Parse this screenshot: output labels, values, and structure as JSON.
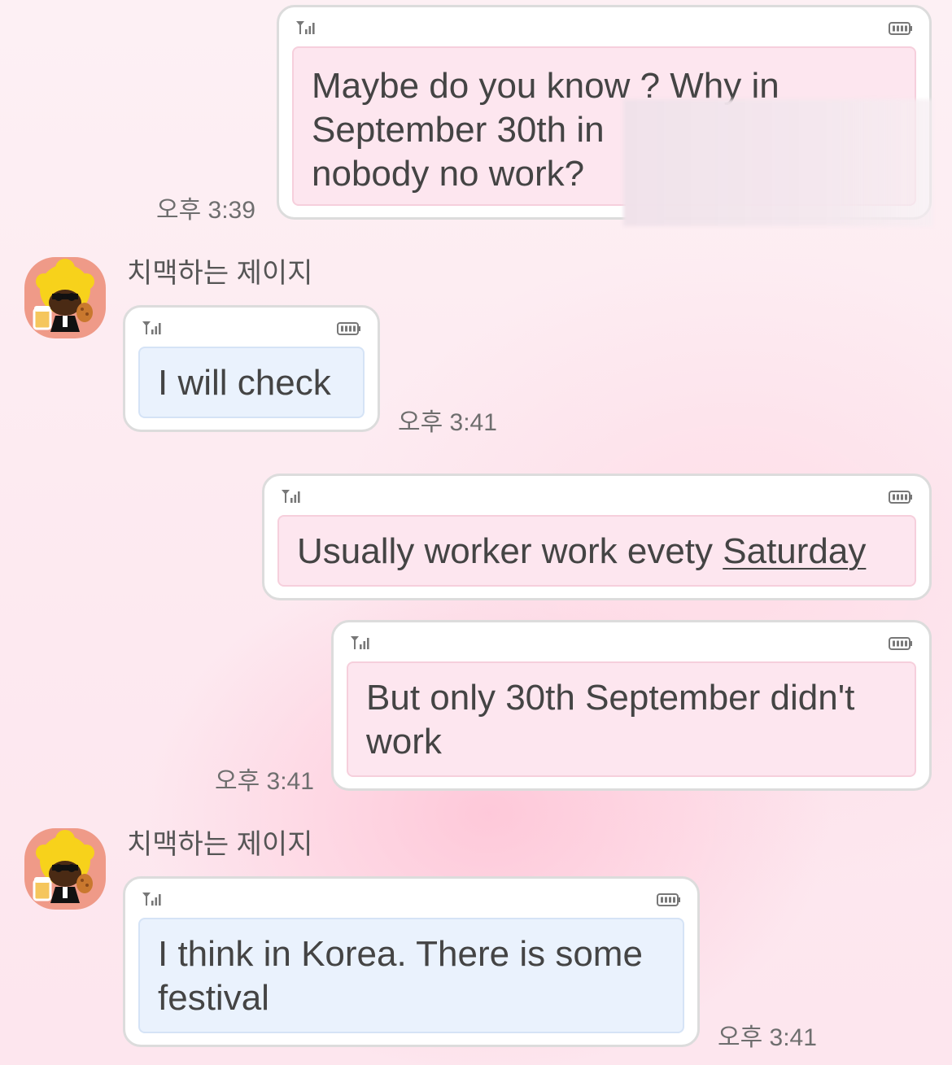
{
  "colors": {
    "background": "#fdeef3",
    "bubble_border": "#dcdcdc",
    "sent_inner": "#fde6ef",
    "received_inner": "#eaf2fd",
    "text": "#444444",
    "avatar_bg": "#ef9a88"
  },
  "messages": [
    {
      "direction": "sent",
      "text": "Maybe do you know ? Why in\nSeptember 30th in\nnobody no work?",
      "time": "오후 3:39",
      "icons": [
        "signal-icon",
        "battery-icon"
      ]
    },
    {
      "direction": "received",
      "sender": "치맥하는 제이지",
      "text": "I will check",
      "time": "오후 3:41",
      "icons": [
        "signal-icon",
        "battery-icon"
      ]
    },
    {
      "direction": "sent",
      "text_before": "Usually worker work evety ",
      "link_text": "Saturday",
      "icons": [
        "signal-icon",
        "battery-icon"
      ]
    },
    {
      "direction": "sent",
      "text": "But only 30th September didn't\nwork",
      "time": "오후 3:41",
      "icons": [
        "signal-icon",
        "battery-icon"
      ]
    },
    {
      "direction": "received",
      "sender": "치맥하는 제이지",
      "text": "I think in Korea. There is some\nfestival",
      "time": "오후 3:41",
      "icons": [
        "signal-icon",
        "battery-icon"
      ]
    }
  ]
}
